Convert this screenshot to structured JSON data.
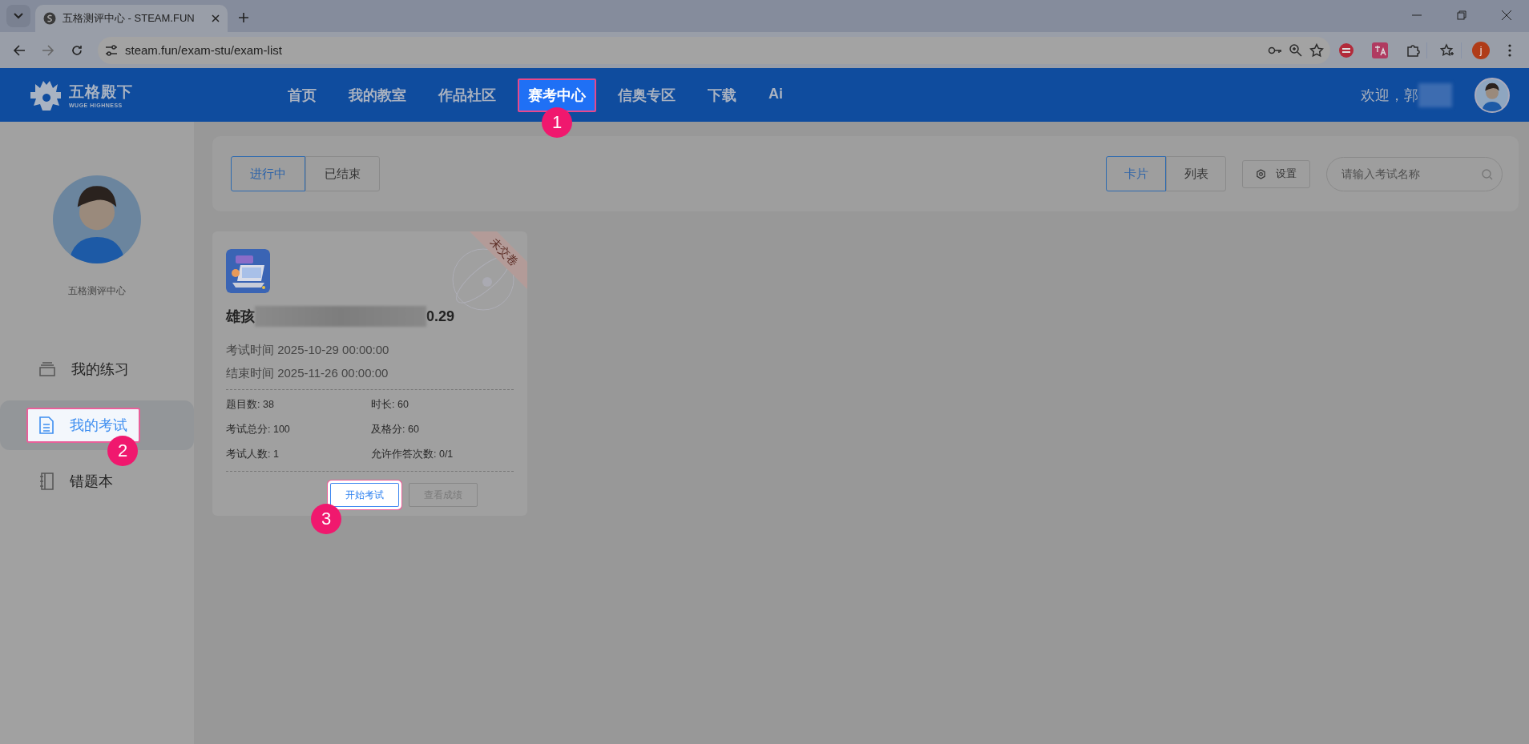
{
  "browser": {
    "tab_title": "五格测评中心 - STEAM.FUN",
    "url": "steam.fun/exam-stu/exam-list",
    "profile_initial": "j"
  },
  "nav": {
    "logo_name": "五格殿下",
    "logo_sub": "WUGE HIGHNESS",
    "welcome": "欢迎，郭",
    "items": [
      {
        "label": "首页",
        "selected": false
      },
      {
        "label": "我的教室",
        "selected": false
      },
      {
        "label": "作品社区",
        "selected": false
      },
      {
        "label": "赛考中心",
        "selected": true,
        "marker": "1"
      },
      {
        "label": "信奥专区",
        "selected": false
      },
      {
        "label": "下载",
        "selected": false
      },
      {
        "label": "Ai",
        "selected": false
      }
    ]
  },
  "sidebar": {
    "name": "五格测评中心",
    "items": [
      {
        "label": "我的练习",
        "kind": "stack",
        "selected": false
      },
      {
        "label": "我的考试",
        "kind": "document",
        "selected": true,
        "marker": "2"
      },
      {
        "label": "错题本",
        "kind": "notebook",
        "selected": false
      }
    ]
  },
  "status_tabs": [
    {
      "label": "进行中",
      "selected": true
    },
    {
      "label": "已结束",
      "selected": false
    }
  ],
  "view_tabs": [
    {
      "label": "卡片",
      "selected": true
    },
    {
      "label": "列表",
      "selected": false
    }
  ],
  "settings_label": "设置",
  "search": {
    "placeholder": "请输入考试名称"
  },
  "cards": [
    {
      "ribbon": "未交卷",
      "title_start": "雄孩",
      "title_end": "0.29",
      "start_time": "考试时间 2025-10-29 00:00:00",
      "end_time": "结束时间 2025-11-26 00:00:00",
      "stats": [
        "题目数: 38",
        "时长: 60",
        "考试总分: 100",
        "及格分: 60",
        "考试人数: 1",
        "允许作答次数: 0/1"
      ],
      "buttons": [
        {
          "label": "开始考试",
          "kind": "primary",
          "marker": "3"
        },
        {
          "label": "查看成绩",
          "kind": "disabled"
        }
      ]
    }
  ]
}
